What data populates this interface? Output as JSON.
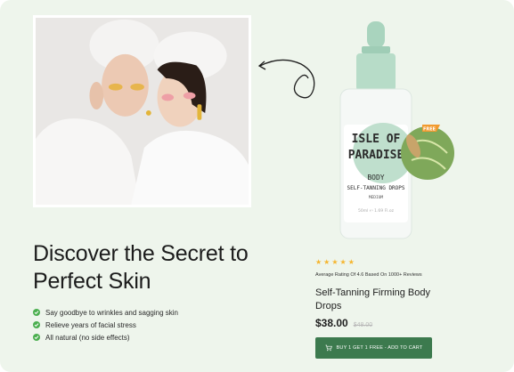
{
  "hero": {
    "headline_line1": "Discover the Secret to",
    "headline_line2": "Perfect Skin",
    "features": [
      "Say goodbye to wrinkles and sagging skin",
      "Relieve years of facial stress",
      "All natural (no side effects)"
    ]
  },
  "product": {
    "bottle_brand_line1": "ISLE OF",
    "bottle_brand_line2": "PARADISE",
    "bottle_label_line1": "BODY",
    "bottle_label_line2": "SELF-TANNING DROPS",
    "bottle_label_line3": "MEDIUM",
    "bottle_volume": "50ml ℮ 1.69 Fl.oz",
    "badge": "FREE",
    "rating_stars": 5,
    "rating_text": "Average Rating Of 4.6 Based On 1000+ Reviews",
    "name": "Self-Tanning Firming Body Drops",
    "price": "$38.00",
    "old_price": "$48.00",
    "cart_button_label": "BUY 1 GET 1 FREE - ADD TO CART"
  },
  "colors": {
    "background": "#eef5ec",
    "accent_green": "#3c7a4e",
    "check_green": "#4caf50",
    "star": "#f5b52e",
    "bottle_mint": "#b9dcc9"
  },
  "icons": {
    "feature_bullet": "check-circle-icon",
    "cart": "cart-icon",
    "star": "star-icon",
    "arrow": "curly-arrow-icon"
  }
}
